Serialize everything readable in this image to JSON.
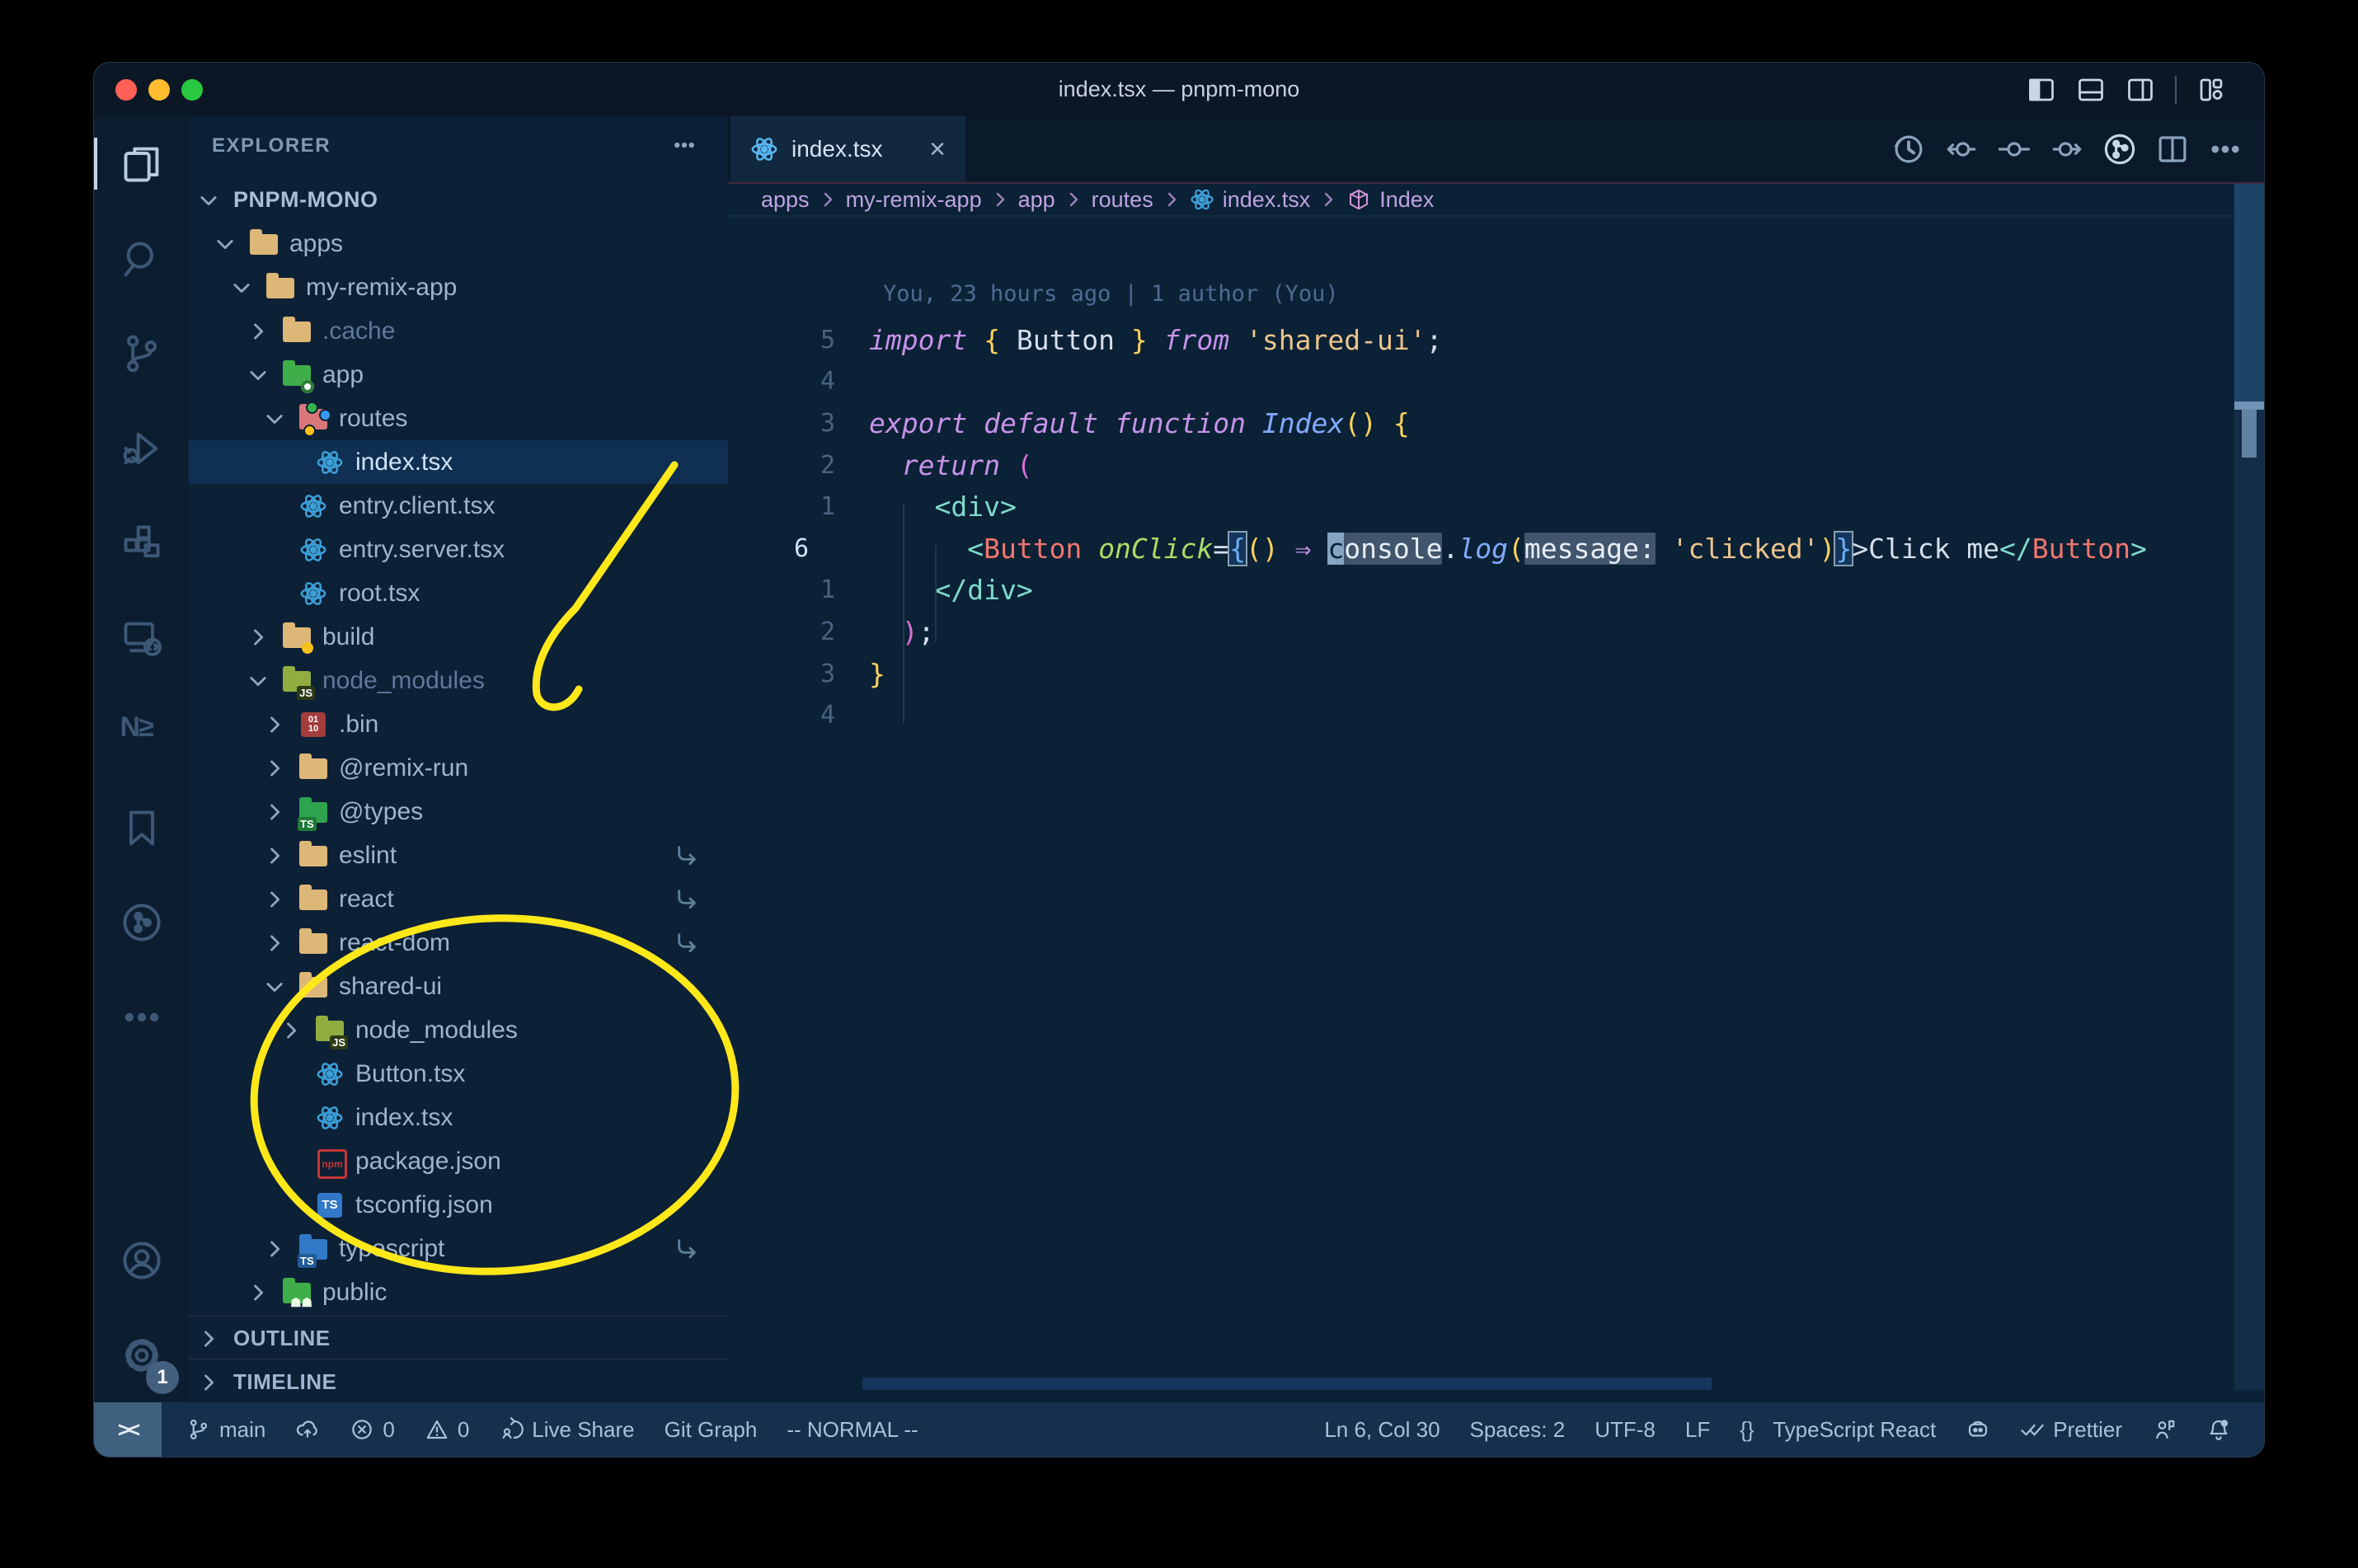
{
  "window": {
    "title": "index.tsx — pnpm-mono",
    "controls": [
      "close",
      "minimize",
      "zoom"
    ],
    "layout_icons": [
      "layout-sidebar-left",
      "layout-panel",
      "layout-sidebar-right",
      "divider",
      "layout-customize"
    ]
  },
  "activity_bar": {
    "top": [
      {
        "name": "explorer",
        "icon": "files",
        "active": true
      },
      {
        "name": "search",
        "icon": "search",
        "active": false
      },
      {
        "name": "source-control",
        "icon": "branch-big",
        "active": false
      },
      {
        "name": "run-debug",
        "icon": "debug",
        "active": false
      },
      {
        "name": "extensions",
        "icon": "extensions",
        "active": false
      },
      {
        "name": "remote-explorer",
        "icon": "remote-monitor",
        "active": false
      },
      {
        "name": "nx-console",
        "icon": "nx",
        "active": false
      },
      {
        "name": "bookmarks",
        "icon": "bookmark",
        "active": false
      },
      {
        "name": "git-graph",
        "icon": "git-circle",
        "active": false
      },
      {
        "name": "more",
        "icon": "dots",
        "active": false
      }
    ],
    "bottom": [
      {
        "name": "accounts",
        "icon": "account"
      },
      {
        "name": "settings",
        "icon": "gear",
        "badge": "1"
      }
    ]
  },
  "explorer": {
    "header": "EXPLORER",
    "sections": {
      "outline": "OUTLINE",
      "timeline": "TIMELINE"
    },
    "tree": [
      {
        "label": "PNPM-MONO",
        "depth": 0,
        "chevron": "down",
        "icon": "none",
        "root": true
      },
      {
        "label": "apps",
        "depth": 1,
        "chevron": "down",
        "icon": "folder"
      },
      {
        "label": "my-remix-app",
        "depth": 2,
        "chevron": "down",
        "icon": "folder"
      },
      {
        "label": ".cache",
        "depth": 3,
        "chevron": "right",
        "icon": "folder",
        "dim": true
      },
      {
        "label": "app",
        "depth": 3,
        "chevron": "down",
        "icon": "folder-app"
      },
      {
        "label": "routes",
        "depth": 4,
        "chevron": "down",
        "icon": "folder-routes"
      },
      {
        "label": "index.tsx",
        "depth": 5,
        "chevron": "none",
        "icon": "react",
        "selected": true
      },
      {
        "label": "entry.client.tsx",
        "depth": 4,
        "chevron": "none",
        "icon": "react"
      },
      {
        "label": "entry.server.tsx",
        "depth": 4,
        "chevron": "none",
        "icon": "react"
      },
      {
        "label": "root.tsx",
        "depth": 4,
        "chevron": "none",
        "icon": "react"
      },
      {
        "label": "build",
        "depth": 3,
        "chevron": "right",
        "icon": "folder-build"
      },
      {
        "label": "node_modules",
        "depth": 3,
        "chevron": "down",
        "icon": "folder-node",
        "dim": true
      },
      {
        "label": ".bin",
        "depth": 4,
        "chevron": "right",
        "icon": "binary"
      },
      {
        "label": "@remix-run",
        "depth": 4,
        "chevron": "right",
        "icon": "folder"
      },
      {
        "label": "@types",
        "depth": 4,
        "chevron": "right",
        "icon": "folder-types"
      },
      {
        "label": "eslint",
        "depth": 4,
        "chevron": "right",
        "icon": "folder",
        "symlink": true
      },
      {
        "label": "react",
        "depth": 4,
        "chevron": "right",
        "icon": "folder",
        "symlink": true
      },
      {
        "label": "react-dom",
        "depth": 4,
        "chevron": "right",
        "icon": "folder",
        "symlink": true
      },
      {
        "label": "shared-ui",
        "depth": 4,
        "chevron": "down",
        "icon": "folder"
      },
      {
        "label": "node_modules",
        "depth": 5,
        "chevron": "right",
        "icon": "folder-node"
      },
      {
        "label": "Button.tsx",
        "depth": 5,
        "chevron": "none",
        "icon": "react"
      },
      {
        "label": "index.tsx",
        "depth": 5,
        "chevron": "none",
        "icon": "react"
      },
      {
        "label": "package.json",
        "depth": 5,
        "chevron": "none",
        "icon": "npm"
      },
      {
        "label": "tsconfig.json",
        "depth": 5,
        "chevron": "none",
        "icon": "tsjson"
      },
      {
        "label": "typescript",
        "depth": 4,
        "chevron": "right",
        "icon": "folder-ts",
        "symlink": true
      },
      {
        "label": "public",
        "depth": 3,
        "chevron": "right",
        "icon": "folder-public"
      }
    ]
  },
  "tab": {
    "label": "index.tsx",
    "close": "×"
  },
  "breadcrumbs": [
    {
      "label": "apps",
      "icon": ""
    },
    {
      "label": "my-remix-app",
      "icon": ""
    },
    {
      "label": "app",
      "icon": ""
    },
    {
      "label": "routes",
      "icon": ""
    },
    {
      "label": "index.tsx",
      "icon": "react"
    },
    {
      "label": "Index",
      "icon": "cube"
    }
  ],
  "editor": {
    "blame": "You, 23 hours ago | 1 author (You)",
    "lines": [
      {
        "gutter": "5",
        "tokens": [
          [
            "kw",
            "import"
          ],
          [
            "txt",
            " "
          ],
          [
            "brace",
            "{"
          ],
          [
            "txt",
            " Button "
          ],
          [
            "brace",
            "}"
          ],
          [
            "txt",
            " "
          ],
          [
            "kw",
            "from"
          ],
          [
            "txt",
            " "
          ],
          [
            "str",
            "'shared-ui'"
          ],
          [
            "txt",
            ";"
          ]
        ]
      },
      {
        "gutter": "4",
        "tokens": []
      },
      {
        "gutter": "3",
        "tokens": [
          [
            "kw",
            "export"
          ],
          [
            "txt",
            " "
          ],
          [
            "kw",
            "default"
          ],
          [
            "txt",
            " "
          ],
          [
            "kw",
            "function"
          ],
          [
            "txt",
            " "
          ],
          [
            "fn",
            "Index"
          ],
          [
            "brace",
            "()"
          ],
          [
            "txt",
            " "
          ],
          [
            "brace",
            "{"
          ]
        ]
      },
      {
        "gutter": "2",
        "tokens": [
          [
            "txt",
            "  "
          ],
          [
            "kw",
            "return"
          ],
          [
            "txt",
            " "
          ],
          [
            "pink",
            "("
          ]
        ]
      },
      {
        "gutter": "1",
        "tokens": [
          [
            "txt",
            "    "
          ],
          [
            "tag",
            "<div>"
          ]
        ]
      },
      {
        "gutter": "6",
        "current": true,
        "tokens": [
          [
            "txt",
            "      "
          ],
          [
            "tag",
            "<"
          ],
          [
            "comp",
            "Button"
          ],
          [
            "txt",
            " "
          ],
          [
            "attr",
            "onClick"
          ],
          [
            "txt",
            "="
          ],
          [
            "bblue",
            "{"
          ],
          [
            "brace",
            "()"
          ],
          [
            "txt",
            " "
          ],
          [
            "arrow",
            "⇒"
          ],
          [
            "txt",
            " "
          ],
          [
            "cursor",
            "c"
          ],
          [
            "hlw",
            "onsole"
          ],
          [
            "txt",
            "."
          ],
          [
            "fn",
            "log"
          ],
          [
            "brace",
            "("
          ],
          [
            "hlw",
            "message:"
          ],
          [
            "txt",
            " "
          ],
          [
            "str",
            "'clicked'"
          ],
          [
            "brace",
            ")"
          ],
          [
            "bblue",
            "}"
          ],
          [
            "txt",
            ">Click me"
          ],
          [
            "tag",
            "</"
          ],
          [
            "comp",
            "Button"
          ],
          [
            "tag",
            ">"
          ]
        ]
      },
      {
        "gutter": "1",
        "tokens": [
          [
            "txt",
            "    "
          ],
          [
            "tag",
            "</div>"
          ]
        ]
      },
      {
        "gutter": "2",
        "tokens": [
          [
            "txt",
            "  "
          ],
          [
            "pink",
            ")"
          ],
          [
            "txt",
            ";"
          ]
        ]
      },
      {
        "gutter": "3",
        "tokens": [
          [
            "brace",
            "}"
          ]
        ]
      },
      {
        "gutter": "4",
        "tokens": []
      }
    ]
  },
  "toolbar": [
    "timeline",
    "prev-change",
    "gitlens",
    "next-change",
    "git-circle-bright",
    "split-editor",
    "more-actions"
  ],
  "status_bar": {
    "remote_glyph": "><",
    "left": [
      {
        "icon": "branch",
        "label": "main",
        "name": "branch-indicator"
      },
      {
        "icon": "cloud-upload",
        "label": "",
        "name": "publish-changes"
      },
      {
        "icon": "error",
        "label": "0",
        "name": "error-count"
      },
      {
        "icon": "warning",
        "label": "0",
        "name": "warning-count"
      },
      {
        "icon": "live-share",
        "label": "Live Share",
        "name": "live-share"
      },
      {
        "icon": "",
        "label": "Git Graph",
        "name": "git-graph"
      },
      {
        "icon": "",
        "label": "-- NORMAL --",
        "name": "vim-mode"
      }
    ],
    "right": [
      {
        "icon": "",
        "label": "Ln 6, Col 30",
        "name": "cursor-position"
      },
      {
        "icon": "",
        "label": "Spaces: 2",
        "name": "indentation"
      },
      {
        "icon": "",
        "label": "UTF-8",
        "name": "encoding"
      },
      {
        "icon": "",
        "label": "LF",
        "name": "eol"
      },
      {
        "icon": "braces",
        "label": "TypeScript React",
        "name": "language-mode"
      },
      {
        "icon": "copilot",
        "label": "",
        "name": "copilot"
      },
      {
        "icon": "checks",
        "label": "Prettier",
        "name": "prettier"
      },
      {
        "icon": "person",
        "label": "",
        "name": "feedback"
      },
      {
        "icon": "bell",
        "label": "",
        "name": "notifications"
      }
    ]
  },
  "annotations": {
    "color": "#ffe81a",
    "shapes": [
      "arrow-to-node-modules",
      "ellipse-around-shared-ui"
    ]
  }
}
